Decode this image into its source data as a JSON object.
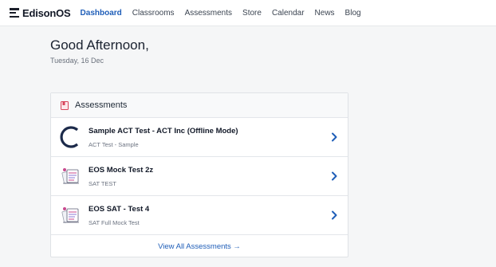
{
  "brand": {
    "name": "EdisonOS"
  },
  "nav": {
    "items": [
      "Dashboard",
      "Classrooms",
      "Assessments",
      "Store",
      "Calendar",
      "News",
      "Blog"
    ],
    "active": "Dashboard"
  },
  "greeting": {
    "title": "Good Afternoon,",
    "date": "Tuesday, 16 Dec"
  },
  "assessments": {
    "header": "Assessments",
    "items": [
      {
        "title": "Sample ACT Test - ACT Inc (Offline Mode)",
        "subtitle": "ACT Test - Sample",
        "icon": "act-logo-icon"
      },
      {
        "title": "EOS Mock Test 2z",
        "subtitle": "SAT TEST",
        "icon": "test-illustration-icon"
      },
      {
        "title": "EOS SAT - Test 4",
        "subtitle": "SAT Full Mock Test",
        "icon": "test-illustration-icon"
      }
    ],
    "view_all": "View All Assessments →"
  },
  "colors": {
    "accent": "#1f5eb8",
    "act_logo": "#1c2a4a",
    "book_icon": "#d8455b"
  }
}
